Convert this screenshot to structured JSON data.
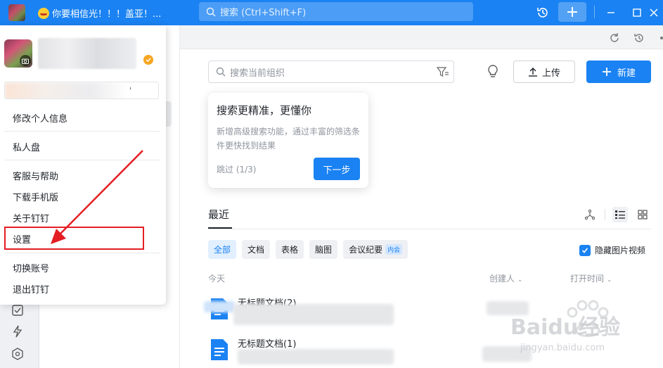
{
  "titlebar": {
    "conversation_title": "你要相信光！！！盖亚！...",
    "search_placeholder": "搜索 (Ctrl+Shift+F)"
  },
  "main": {
    "search_placeholder": "搜索当前组织",
    "upload_label": "上传",
    "new_label": "新建"
  },
  "tip": {
    "title": "搜索更精准，更懂你",
    "body": "新增高级搜索功能，通过丰富的筛选条件更快找到结果",
    "skip": "跳过 (1/3)",
    "next": "下一步"
  },
  "recent": {
    "title": "最近",
    "filters": [
      {
        "label": "全部",
        "active": true
      },
      {
        "label": "文档"
      },
      {
        "label": "表格"
      },
      {
        "label": "脑图"
      },
      {
        "label": "会议纪要",
        "badge": "内会"
      }
    ],
    "hide_media_label": "隐藏图片视频",
    "hide_media_checked": true,
    "columns": {
      "group": "今天",
      "creator": "创建人",
      "opened": "打开时间"
    },
    "rows": [
      {
        "name": "无标题文档(2)"
      },
      {
        "name": "无标题文档(1)"
      }
    ]
  },
  "menu": {
    "items": [
      "修改个人信息",
      "私人盘",
      "客服与帮助",
      "下载手机版",
      "关于钉钉",
      "设置",
      "切换账号",
      "退出钉钉"
    ],
    "status_trailing": "'"
  },
  "watermark": {
    "brand": "Baidu经验",
    "url": "jingyan.baidu.com"
  },
  "colors": {
    "brand": "#1a82f2",
    "annotation": "#e31e24"
  }
}
